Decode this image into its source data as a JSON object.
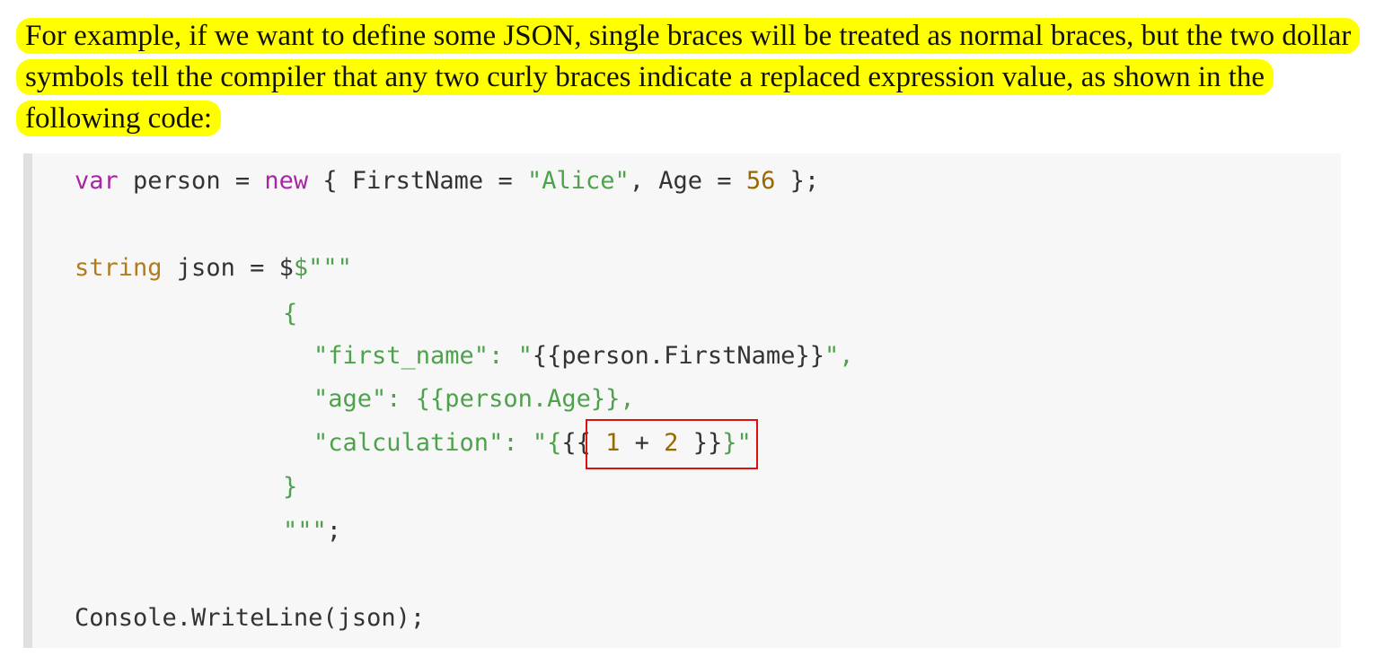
{
  "paragraph": {
    "text": "For example, if we want to define some JSON, single braces will be treated as normal braces, but the two dollar symbols tell the compiler that any two curly braces indicate a replaced expression value, as shown in the following code:"
  },
  "code": {
    "line1": {
      "kw_var": "var",
      "t1": " person = ",
      "kw_new": "new",
      "t2": " { FirstName = ",
      "s_alice": "\"Alice\"",
      "t3": ", Age = ",
      "n56": "56",
      "t4": " };"
    },
    "line3": {
      "ty_string": "string",
      "t1": " json = ",
      "dollar": "$",
      "s_open": "$\"\"\""
    },
    "line4": {
      "brace": "{"
    },
    "line5": {
      "s1": "\"first_name\": \"",
      "expr": "{{person.FirstName}}",
      "s2": "\","
    },
    "line6": {
      "s1": "\"age\": ",
      "expr": "{{person.Age}}",
      "s2": ","
    },
    "line7": {
      "s1": "\"calculation\": \"{",
      "open": "{{ ",
      "n1": "1",
      "op": " + ",
      "n2": "2",
      "close": " }}",
      "s2": "}\""
    },
    "line8": {
      "brace": "}"
    },
    "line9": {
      "s_close": "\"\"\"",
      "semi": ";"
    },
    "line11": {
      "text": "Console.WriteLine(json);"
    }
  },
  "colors": {
    "highlight": "#ffff00",
    "keyword": "#a626a4",
    "type": "#b07d1a",
    "string": "#4ea24c",
    "number": "#986801",
    "box": "#e01010"
  }
}
